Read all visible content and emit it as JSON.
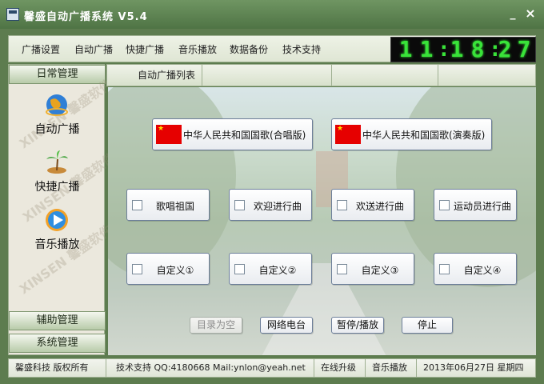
{
  "window": {
    "title": "馨盛自动广播系统 V5.4",
    "minimize_symbol": "_",
    "close_symbol": "×"
  },
  "menu": {
    "items": [
      "广播设置",
      "自动广播",
      "快捷广播",
      "音乐播放",
      "数据备份",
      "技术支持"
    ]
  },
  "clock": {
    "hour": [
      "1",
      "1"
    ],
    "minute": [
      "1",
      "8"
    ],
    "second": [
      "2",
      "7"
    ],
    "separator": ":",
    "color": "#39e339"
  },
  "sidebar": {
    "header_top": "日常管理",
    "watermark": "XINSEN 馨盛软件",
    "items": [
      {
        "label": "自动广播",
        "icon": "globe-icon"
      },
      {
        "label": "快捷广播",
        "icon": "palm-tree-icon"
      },
      {
        "label": "音乐播放",
        "icon": "play-icon"
      }
    ],
    "header_aux": "辅助管理",
    "header_sys": "系统管理"
  },
  "tabs": {
    "active": "自动广播列表"
  },
  "anthems": [
    {
      "label": "中华人民共和国国歌(合唱版)",
      "icon": "china-flag-icon"
    },
    {
      "label": "中华人民共和国国歌(演奏版)",
      "icon": "china-flag-icon"
    }
  ],
  "songs_row1": [
    "歌唱祖国",
    "欢迎进行曲",
    "欢送进行曲",
    "运动员进行曲"
  ],
  "songs_row2": [
    "自定义①",
    "自定义②",
    "自定义③",
    "自定义④"
  ],
  "controls": {
    "clear": "目录为空",
    "radio": "网络电台",
    "pause_play": "暂停/播放",
    "stop": "停止"
  },
  "status": {
    "company": "馨盛科技 版权所有",
    "support": "技术支持 QQ:4180668  Mail:ynlon@yeah.net",
    "upgrade": "在线升级",
    "music": "音乐播放",
    "date": "2013年06月27日 星期四"
  },
  "colors": {
    "theme_green": "#5d7c4f",
    "flag_red": "#e60000",
    "flag_star": "#ffde00"
  }
}
